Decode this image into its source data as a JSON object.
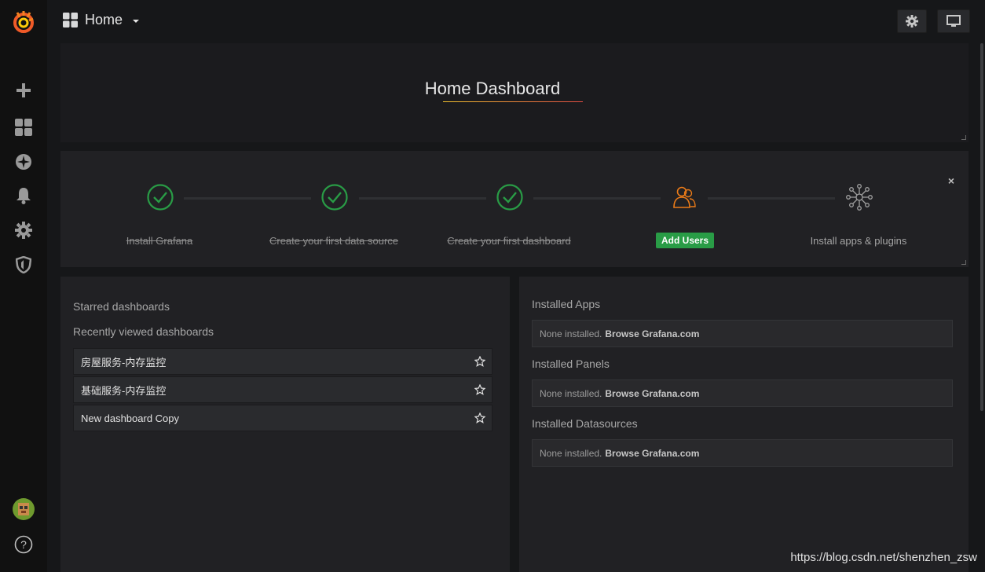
{
  "header": {
    "home_label": "Home",
    "settings_icon": "gear-icon",
    "tv_icon": "monitor-icon"
  },
  "sidebar": {
    "items": [
      {
        "icon": "grafana-logo-icon"
      },
      {
        "icon": "plus-icon"
      },
      {
        "icon": "dashboards-grid-icon"
      },
      {
        "icon": "compass-explore-icon"
      },
      {
        "icon": "bell-alerting-icon"
      },
      {
        "icon": "gear-configuration-icon"
      },
      {
        "icon": "shield-admin-icon"
      },
      {
        "icon": "user-avatar-icon"
      },
      {
        "icon": "help-question-icon"
      }
    ]
  },
  "main": {
    "title": "Home Dashboard"
  },
  "getting_started": {
    "steps": [
      {
        "label": "Install Grafana",
        "done": true
      },
      {
        "label": "Create your first data source",
        "done": true
      },
      {
        "label": "Create your first dashboard",
        "done": true
      },
      {
        "label": "Add Users",
        "done": false
      },
      {
        "label": "Install apps & plugins",
        "done": false
      }
    ],
    "close": "×"
  },
  "dashboards": {
    "starred_heading": "Starred dashboards",
    "recent_heading": "Recently viewed dashboards",
    "recent": [
      {
        "title": "房屋服务-内存监控"
      },
      {
        "title": "基础服务-内存监控"
      },
      {
        "title": "New dashboard Copy"
      }
    ]
  },
  "plugins": {
    "sections": [
      {
        "heading": "Installed Apps",
        "empty": "None installed.",
        "link": "Browse Grafana.com"
      },
      {
        "heading": "Installed Panels",
        "empty": "None installed.",
        "link": "Browse Grafana.com"
      },
      {
        "heading": "Installed Datasources",
        "empty": "None installed.",
        "link": "Browse Grafana.com"
      }
    ]
  },
  "watermark": "https://blog.csdn.net/shenzhen_zsw",
  "colors": {
    "success": "#299c46",
    "done_check": "#299c46",
    "add_users_icon": "#eb7b18",
    "background": "#161719",
    "panel": "#212124"
  }
}
